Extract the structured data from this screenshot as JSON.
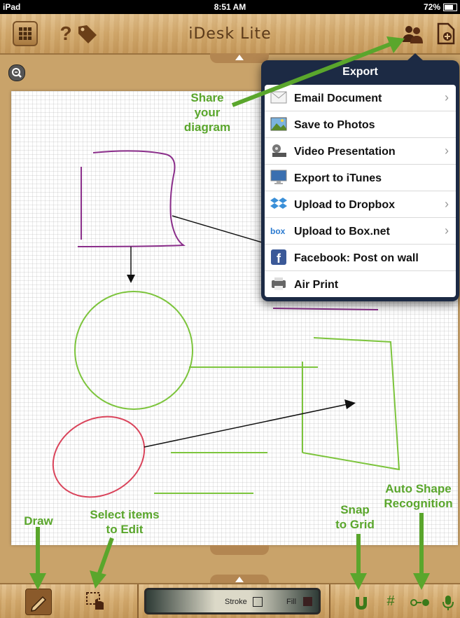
{
  "status_bar": {
    "carrier": "iPad",
    "time": "8:51 AM",
    "battery": "72%"
  },
  "app": {
    "title": "iDesk Lite"
  },
  "toolbar": {
    "grid_menu_icon": "grid-icon",
    "help_label": "?",
    "tag_icon": "price-tag-icon",
    "share_icon": "people-icon",
    "new_doc_icon": "new-document-icon"
  },
  "export_menu": {
    "title": "Export",
    "items": [
      {
        "label": "Email Document",
        "icon": "envelope-icon",
        "has_chevron": true
      },
      {
        "label": "Save to Photos",
        "icon": "photos-icon",
        "has_chevron": false
      },
      {
        "label": "Video Presentation",
        "icon": "film-reel-icon",
        "has_chevron": true
      },
      {
        "label": "Export to iTunes",
        "icon": "monitor-icon",
        "has_chevron": false
      },
      {
        "label": "Upload to Dropbox",
        "icon": "dropbox-icon",
        "has_chevron": true
      },
      {
        "label": "Upload to Box.net",
        "icon": "box-icon",
        "has_chevron": true
      },
      {
        "label": "Facebook: Post on wall",
        "icon": "facebook-icon",
        "has_chevron": false
      },
      {
        "label": "Air Print",
        "icon": "printer-icon",
        "has_chevron": false
      }
    ]
  },
  "bottom_toolbar": {
    "stroke_label": "Stroke",
    "fill_label": "Fill"
  },
  "callouts": {
    "share": "Share your diagram",
    "share_lines": [
      "Share",
      "your",
      "diagram"
    ],
    "draw": "Draw",
    "select": "Select items to Edit",
    "select_lines": [
      "Select items",
      "to Edit"
    ],
    "snap": "Snap to Grid",
    "snap_lines": [
      "Snap",
      "to Grid"
    ],
    "auto_shape": "Auto Shape Recognition",
    "auto_shape_lines": [
      "Auto Shape",
      "Recognition"
    ]
  },
  "colors": {
    "callout_green": "#5aa62c",
    "shape_purple": "#8a2d8a",
    "shape_green": "#7cc43c",
    "shape_red": "#d9435a",
    "popover_bg": "#1c2a44"
  }
}
